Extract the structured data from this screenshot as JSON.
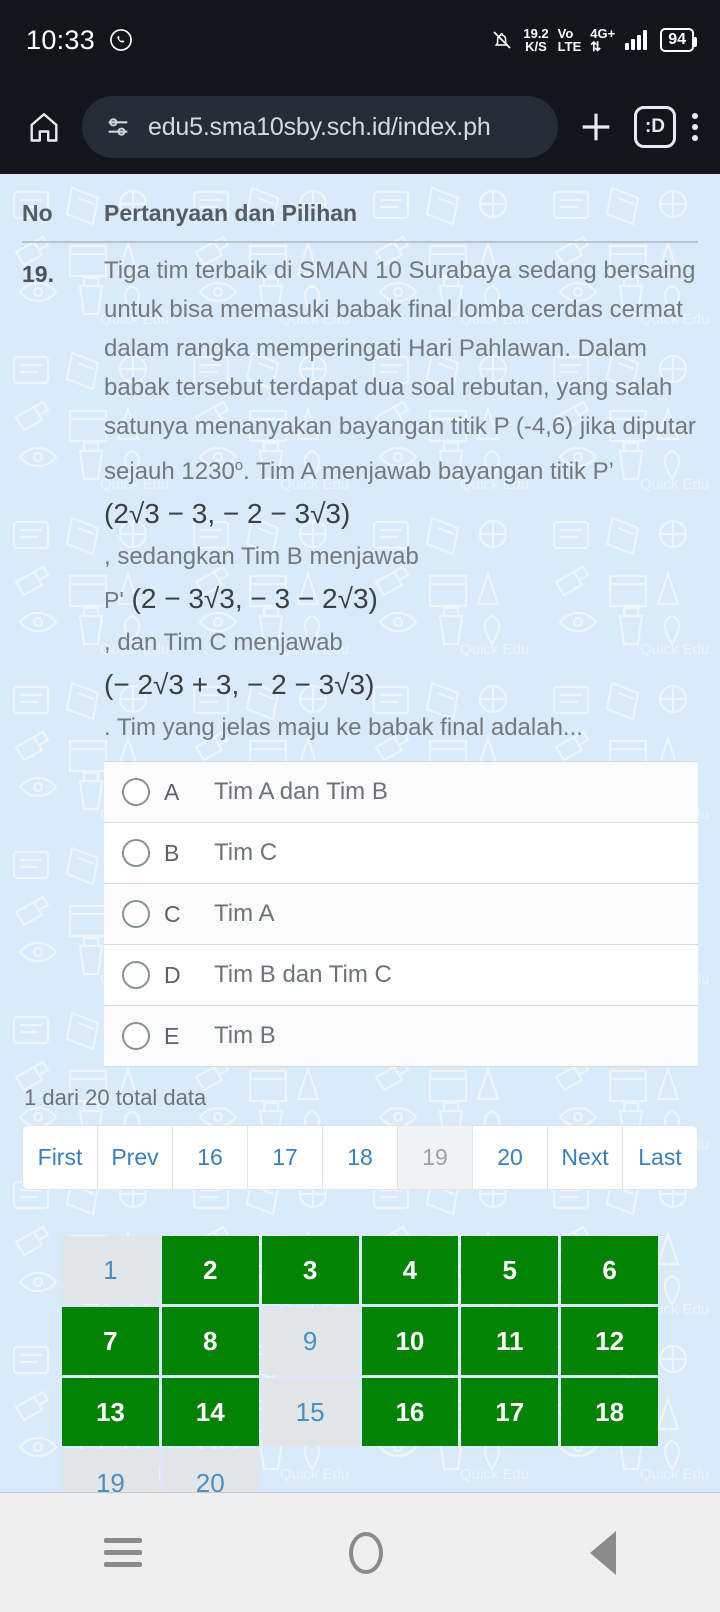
{
  "statusbar": {
    "time": "10:33",
    "whatsapp_icon": "whatsapp-icon",
    "bell_icon": "bell-muted-icon",
    "net_speed_value": "19.2",
    "net_speed_unit": "K/S",
    "volte_top": "Vo",
    "volte_bottom": "LTE",
    "network_type": "4G+",
    "signal_icon": "signal-bars-icon",
    "battery_level": "94"
  },
  "browser": {
    "home_icon": "home-icon",
    "site_settings_icon": "site-settings-icon",
    "url": "edu5.sma10sby.sch.id/index.ph",
    "new_tab_icon": "plus-icon",
    "tab_count_label": ":D",
    "menu_icon": "three-dot-menu-icon"
  },
  "table_header": {
    "col_no": "No",
    "col_question": "Pertanyaan dan Pilihan"
  },
  "question": {
    "number": "19.",
    "para1": "Tiga tim terbaik di SMAN 10 Surabaya sedang bersaing untuk bisa memasuki babak final lomba cerdas cermat dalam rangka memperingati Hari Pahlawan. Dalam babak tersebut terdapat dua soal rebutan, yang salah satunya menanyakan bayangan titik P (-4,6) jika diputar sejauh",
    "angle_value": "1230",
    "angle_unit": "o",
    "after_angle": ". Tim A menjawab bayangan titik P’",
    "math_a": "(2√3 − 3, − 2 − 3√3)",
    "mid1": ", sedangkan Tim B menjawab",
    "label_p2": "P'",
    "math_b": "(2 − 3√3, − 3 − 2√3)",
    "mid2": ", dan Tim C menjawab",
    "math_c": "(− 2√3 + 3, − 2 − 3√3)",
    "tail": ". Tim yang jelas maju ke babak final adalah..."
  },
  "options": [
    {
      "letter": "A",
      "text": "Tim A dan Tim B"
    },
    {
      "letter": "B",
      "text": "Tim C"
    },
    {
      "letter": "C",
      "text": "Tim A"
    },
    {
      "letter": "D",
      "text": "Tim B dan Tim C"
    },
    {
      "letter": "E",
      "text": "Tim B"
    }
  ],
  "total_text": "1 dari 20 total data",
  "pagination": [
    {
      "label": "First",
      "active": false
    },
    {
      "label": "Prev",
      "active": false
    },
    {
      "label": "16",
      "active": false
    },
    {
      "label": "17",
      "active": false
    },
    {
      "label": "18",
      "active": false
    },
    {
      "label": "19",
      "active": true
    },
    {
      "label": "20",
      "active": false
    },
    {
      "label": "Next",
      "active": false
    },
    {
      "label": "Last",
      "active": false
    }
  ],
  "number_grid": [
    {
      "n": "1",
      "state": "todo"
    },
    {
      "n": "2",
      "state": "done"
    },
    {
      "n": "3",
      "state": "done"
    },
    {
      "n": "4",
      "state": "done"
    },
    {
      "n": "5",
      "state": "done"
    },
    {
      "n": "6",
      "state": "done"
    },
    {
      "n": "7",
      "state": "done"
    },
    {
      "n": "8",
      "state": "done"
    },
    {
      "n": "9",
      "state": "todo"
    },
    {
      "n": "10",
      "state": "done"
    },
    {
      "n": "11",
      "state": "done"
    },
    {
      "n": "12",
      "state": "done"
    },
    {
      "n": "13",
      "state": "done"
    },
    {
      "n": "14",
      "state": "done"
    },
    {
      "n": "15",
      "state": "todo"
    },
    {
      "n": "16",
      "state": "done"
    },
    {
      "n": "17",
      "state": "done"
    },
    {
      "n": "18",
      "state": "done"
    },
    {
      "n": "19",
      "state": "todo"
    },
    {
      "n": "20",
      "state": "todo"
    }
  ],
  "navbar": {
    "recents_icon": "recents-icon",
    "home_icon": "home-circle-icon",
    "back_icon": "back-triangle-icon"
  },
  "colors": {
    "done_green": "#048204",
    "todo_gray": "#e2e6e9",
    "link_blue": "#3c7fb9",
    "page_bg": "#d9eafa"
  }
}
